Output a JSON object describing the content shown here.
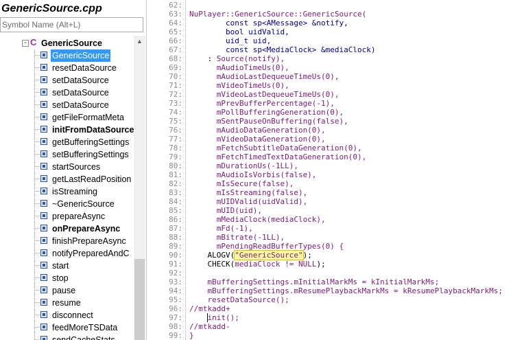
{
  "file_title": "GenericSource.cpp",
  "search": {
    "placeholder": "Symbol Name (Alt+L)",
    "value": ""
  },
  "tree": {
    "class_name": "GenericSource",
    "expander_symbol": "−",
    "class_icon_glyph": "C",
    "selected_index": 0,
    "items": [
      {
        "label": "GenericSource",
        "bold": false
      },
      {
        "label": "resetDataSource",
        "bold": false
      },
      {
        "label": "setDataSource",
        "bold": false
      },
      {
        "label": "setDataSource",
        "bold": false
      },
      {
        "label": "setDataSource",
        "bold": false
      },
      {
        "label": "getFileFormatMeta",
        "bold": false
      },
      {
        "label": "initFromDataSource",
        "bold": true
      },
      {
        "label": "getBufferingSettings",
        "bold": false
      },
      {
        "label": "setBufferingSettings",
        "bold": false
      },
      {
        "label": "startSources",
        "bold": false
      },
      {
        "label": "getLastReadPosition",
        "bold": false
      },
      {
        "label": "isStreaming",
        "bold": false
      },
      {
        "label": "~GenericSource",
        "bold": false
      },
      {
        "label": "prepareAsync",
        "bold": false
      },
      {
        "label": "onPrepareAsync",
        "bold": true
      },
      {
        "label": "finishPrepareAsync",
        "bold": false
      },
      {
        "label": "notifyPreparedAndC",
        "bold": false
      },
      {
        "label": "start",
        "bold": false
      },
      {
        "label": "stop",
        "bold": false
      },
      {
        "label": "pause",
        "bold": false
      },
      {
        "label": "resume",
        "bold": false
      },
      {
        "label": "disconnect",
        "bold": false
      },
      {
        "label": "feedMoreTSData",
        "bold": false
      },
      {
        "label": "sendCacheStats",
        "bold": false
      }
    ]
  },
  "scrollbar": {
    "up_arrow": "▲"
  },
  "editor": {
    "caret_line": 97,
    "lines": [
      {
        "n": "62",
        "segs": []
      },
      {
        "n": "63",
        "segs": [
          {
            "t": "NuPlayer::GenericSource::GenericSource(",
            "c": "fn"
          }
        ]
      },
      {
        "n": "64",
        "segs": [
          {
            "t": "        const sp<AMessage> &notify,",
            "c": "type"
          }
        ]
      },
      {
        "n": "65",
        "segs": [
          {
            "t": "        bool uidValid,",
            "c": "type"
          }
        ]
      },
      {
        "n": "66",
        "segs": [
          {
            "t": "        uid_t uid,",
            "c": "type"
          }
        ]
      },
      {
        "n": "67",
        "segs": [
          {
            "t": "        const sp<MediaClock> &mediaClock)",
            "c": "type"
          }
        ]
      },
      {
        "n": "68",
        "segs": [
          {
            "t": "    : ",
            "c": "punc"
          },
          {
            "t": "Source(notify),",
            "c": "mem"
          }
        ]
      },
      {
        "n": "69",
        "segs": [
          {
            "t": "      mAudioTimeUs(0),",
            "c": "mem"
          }
        ]
      },
      {
        "n": "70",
        "segs": [
          {
            "t": "      mAudioLastDequeueTimeUs(0),",
            "c": "mem"
          }
        ]
      },
      {
        "n": "71",
        "segs": [
          {
            "t": "      mVideoTimeUs(0),",
            "c": "mem"
          }
        ]
      },
      {
        "n": "72",
        "segs": [
          {
            "t": "      mVideoLastDequeueTimeUs(0),",
            "c": "mem"
          }
        ]
      },
      {
        "n": "73",
        "segs": [
          {
            "t": "      mPrevBufferPercentage(-1),",
            "c": "mem"
          }
        ]
      },
      {
        "n": "74",
        "segs": [
          {
            "t": "      mPollBufferingGeneration(0),",
            "c": "mem"
          }
        ]
      },
      {
        "n": "75",
        "segs": [
          {
            "t": "      mSentPauseOnBuffering(false),",
            "c": "mem"
          }
        ]
      },
      {
        "n": "76",
        "segs": [
          {
            "t": "      mAudioDataGeneration(0),",
            "c": "mem"
          }
        ]
      },
      {
        "n": "77",
        "segs": [
          {
            "t": "      mVideoDataGeneration(0),",
            "c": "mem"
          }
        ]
      },
      {
        "n": "78",
        "segs": [
          {
            "t": "      mFetchSubtitleDataGeneration(0),",
            "c": "mem"
          }
        ]
      },
      {
        "n": "79",
        "segs": [
          {
            "t": "      mFetchTimedTextDataGeneration(0),",
            "c": "mem"
          }
        ]
      },
      {
        "n": "80",
        "segs": [
          {
            "t": "      mDurationUs(-1LL),",
            "c": "mem"
          }
        ]
      },
      {
        "n": "81",
        "segs": [
          {
            "t": "      mAudioIsVorbis(false),",
            "c": "mem"
          }
        ]
      },
      {
        "n": "82",
        "segs": [
          {
            "t": "      mIsSecure(false),",
            "c": "mem"
          }
        ]
      },
      {
        "n": "83",
        "segs": [
          {
            "t": "      mIsStreaming(false),",
            "c": "mem"
          }
        ]
      },
      {
        "n": "84",
        "segs": [
          {
            "t": "      mUIDValid(uidValid),",
            "c": "mem"
          }
        ]
      },
      {
        "n": "85",
        "segs": [
          {
            "t": "      mUID(uid),",
            "c": "mem"
          }
        ]
      },
      {
        "n": "86",
        "segs": [
          {
            "t": "      mMediaClock(mediaClock),",
            "c": "mem"
          }
        ]
      },
      {
        "n": "87",
        "segs": [
          {
            "t": "      mFd(-1),",
            "c": "mem"
          }
        ]
      },
      {
        "n": "88",
        "segs": [
          {
            "t": "      mBitrate(-1LL),",
            "c": "mem"
          }
        ]
      },
      {
        "n": "89",
        "segs": [
          {
            "t": "      mPendingReadBufferTypes(0) {",
            "c": "mem"
          }
        ]
      },
      {
        "n": "90",
        "segs": [
          {
            "t": "    ALOGV(",
            "c": "punc"
          },
          {
            "t": "\"GenericSource\"",
            "c": "str"
          },
          {
            "t": ");",
            "c": "punc"
          }
        ]
      },
      {
        "n": "91",
        "segs": [
          {
            "t": "    CHECK(",
            "c": "punc"
          },
          {
            "t": "mediaClock != NULL",
            "c": "mem"
          },
          {
            "t": ");",
            "c": "punc"
          }
        ]
      },
      {
        "n": "92",
        "segs": []
      },
      {
        "n": "93",
        "segs": [
          {
            "t": "    mBufferingSettings.mInitialMarkMs = kInitialMarkMs;",
            "c": "mem"
          }
        ]
      },
      {
        "n": "94",
        "segs": [
          {
            "t": "    mBufferingSettings.mResumePlaybackMarkMs = kResumePlaybackMarkMs;",
            "c": "mem"
          }
        ]
      },
      {
        "n": "95",
        "segs": [
          {
            "t": "    resetDataSource();",
            "c": "mem"
          }
        ]
      },
      {
        "n": "96",
        "segs": [
          {
            "t": "//mtkadd+",
            "c": "comment"
          }
        ]
      },
      {
        "n": "97",
        "segs": [
          {
            "t": "    init();",
            "c": "mem"
          }
        ]
      },
      {
        "n": "98",
        "segs": [
          {
            "t": "//mtkadd-",
            "c": "comment"
          }
        ]
      },
      {
        "n": "99",
        "segs": [
          {
            "t": "}",
            "c": "mem"
          }
        ]
      }
    ]
  }
}
